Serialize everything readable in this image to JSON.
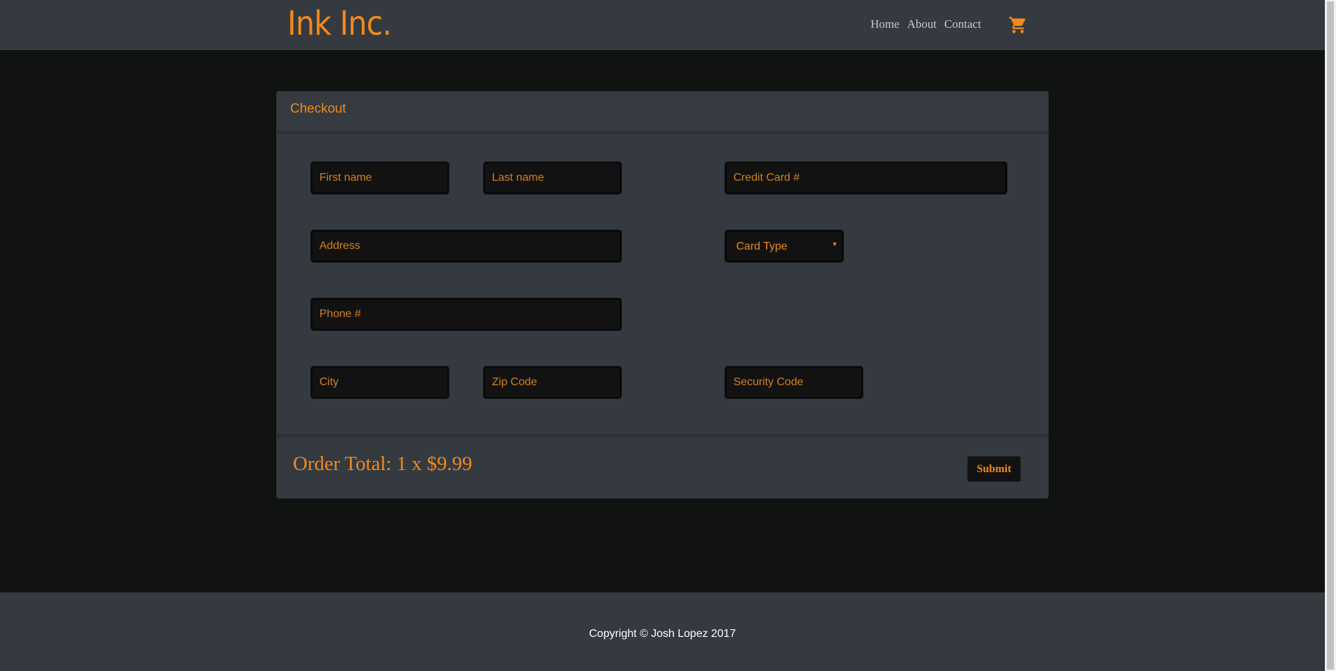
{
  "navbar": {
    "brand": "Ink Inc.",
    "links": [
      "Home",
      "About",
      "Contact"
    ],
    "cart_icon": "shopping-cart-icon"
  },
  "checkout": {
    "title": "Checkout",
    "fields": {
      "first_name": "First name",
      "last_name": "Last name",
      "credit_card": "Credit Card #",
      "address": "Address",
      "phone": "Phone #",
      "city": "City",
      "zip": "Zip Code",
      "security_code": "Security Code"
    },
    "card_type": {
      "selected": "Card Type"
    },
    "order_total": "Order Total: 1 x $9.99",
    "submit_label": "Submit"
  },
  "footer": {
    "copyright": "Copyright © Josh Lopez 2017"
  },
  "colors": {
    "accent": "#f18a1c",
    "panel": "#343a40",
    "background": "#111212",
    "input": "#121212"
  }
}
